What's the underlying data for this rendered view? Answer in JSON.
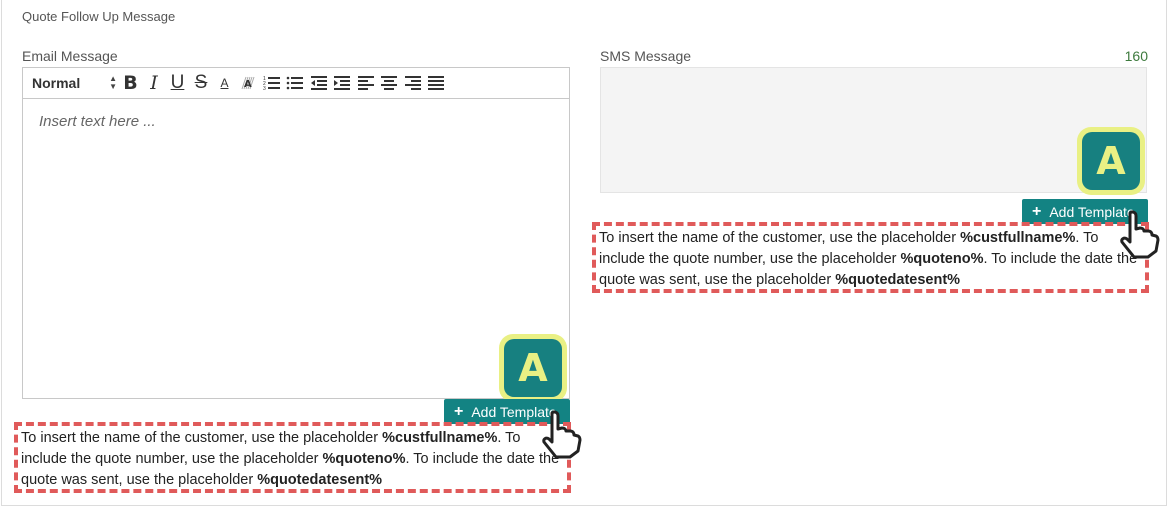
{
  "section_title": "Quote Follow Up Message",
  "email": {
    "label": "Email Message",
    "format_select": "Normal",
    "toolbar_icons": [
      "bold-icon",
      "italic-icon",
      "underline-icon",
      "strikethrough-icon",
      "text-color-icon",
      "highlight-icon",
      "ordered-list-icon",
      "bullet-list-icon",
      "outdent-icon",
      "indent-icon",
      "align-left-icon",
      "align-center-icon",
      "align-right-icon",
      "justify-icon"
    ],
    "placeholder": "Insert text here ...",
    "add_template": "Add Template",
    "badge": "A"
  },
  "sms": {
    "label": "SMS Message",
    "char_count": "160",
    "add_template": "Add Template",
    "badge": "A"
  },
  "note": {
    "part1": "To insert the name of the customer, use the placeholder ",
    "ph1": "%custfullname%",
    "part2": ". To include the quote number, use the placeholder ",
    "ph2": "%quoteno%",
    "part3": ". To include the date the quote was sent, use the placeholder ",
    "ph3": "%quotedatesent%"
  },
  "colors": {
    "accent": "#138383",
    "badge_bg": "#e9f084",
    "dash": "#e05a5a",
    "count": "#3d7a3d"
  }
}
